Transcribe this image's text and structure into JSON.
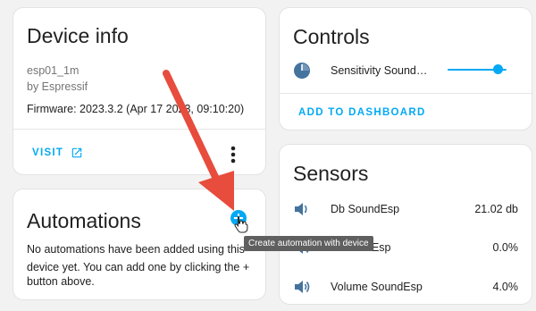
{
  "device_info": {
    "title": "Device info",
    "model": "esp01_1m",
    "manufacturer": "by Espressif",
    "firmware": "Firmware: 2023.3.2 (Apr 17 2023, 09:10:20)",
    "visit_label": "VISIT"
  },
  "automations": {
    "title": "Automations",
    "empty_text_line1": "No automations have been added using this",
    "empty_text_line2": "device yet. You can add one by clicking the +",
    "empty_text_line3": "button above.",
    "tooltip": "Create automation with device"
  },
  "controls": {
    "title": "Controls",
    "items": [
      {
        "label": "Sensitivity Sound…",
        "icon": "gauge-icon",
        "slider_fraction": 0.85
      }
    ],
    "add_to_dashboard_label": "ADD TO DASHBOARD"
  },
  "sensors": {
    "title": "Sensors",
    "items": [
      {
        "label": "Db SoundEsp",
        "value": "21.02 db",
        "icon": "sound-wave-icon"
      },
      {
        "label": "dEsp",
        "value": "0.0%",
        "icon": "volume-icon"
      },
      {
        "label": "Volume SoundEsp",
        "value": "4.0%",
        "icon": "volume-icon"
      }
    ]
  },
  "colors": {
    "accent": "#03a9f4",
    "arrow": "#e74c3c",
    "icon": "#44739e"
  }
}
